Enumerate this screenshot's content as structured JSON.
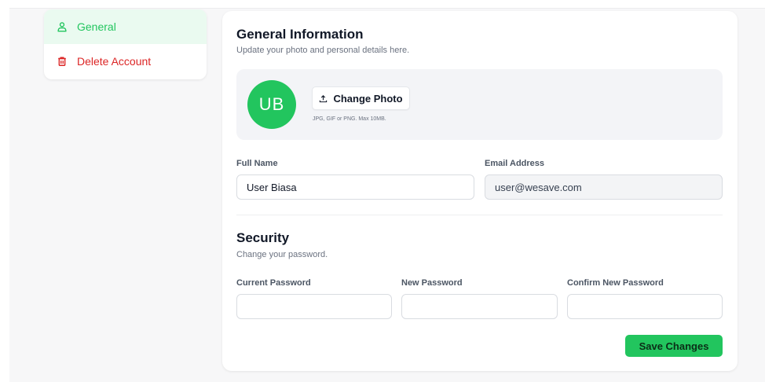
{
  "sidebar": {
    "items": [
      {
        "label": "General",
        "icon": "user-icon",
        "active": true
      },
      {
        "label": "Delete Account",
        "icon": "trash-icon",
        "active": false
      }
    ]
  },
  "general": {
    "title": "General Information",
    "subtitle": "Update your photo and personal details here.",
    "avatar_initials": "UB",
    "change_photo_label": "Change Photo",
    "photo_hint": "JPG, GIF or PNG. Max 10MB.",
    "full_name_label": "Full Name",
    "full_name_value": "User Biasa",
    "email_label": "Email Address",
    "email_value": "user@wesave.com"
  },
  "security": {
    "title": "Security",
    "subtitle": "Change your password.",
    "current_password_label": "Current Password",
    "new_password_label": "New Password",
    "confirm_password_label": "Confirm New Password"
  },
  "actions": {
    "save_label": "Save Changes"
  },
  "colors": {
    "accent": "#22c55e",
    "accent_bg": "#eafaf0",
    "danger": "#dc2626"
  }
}
